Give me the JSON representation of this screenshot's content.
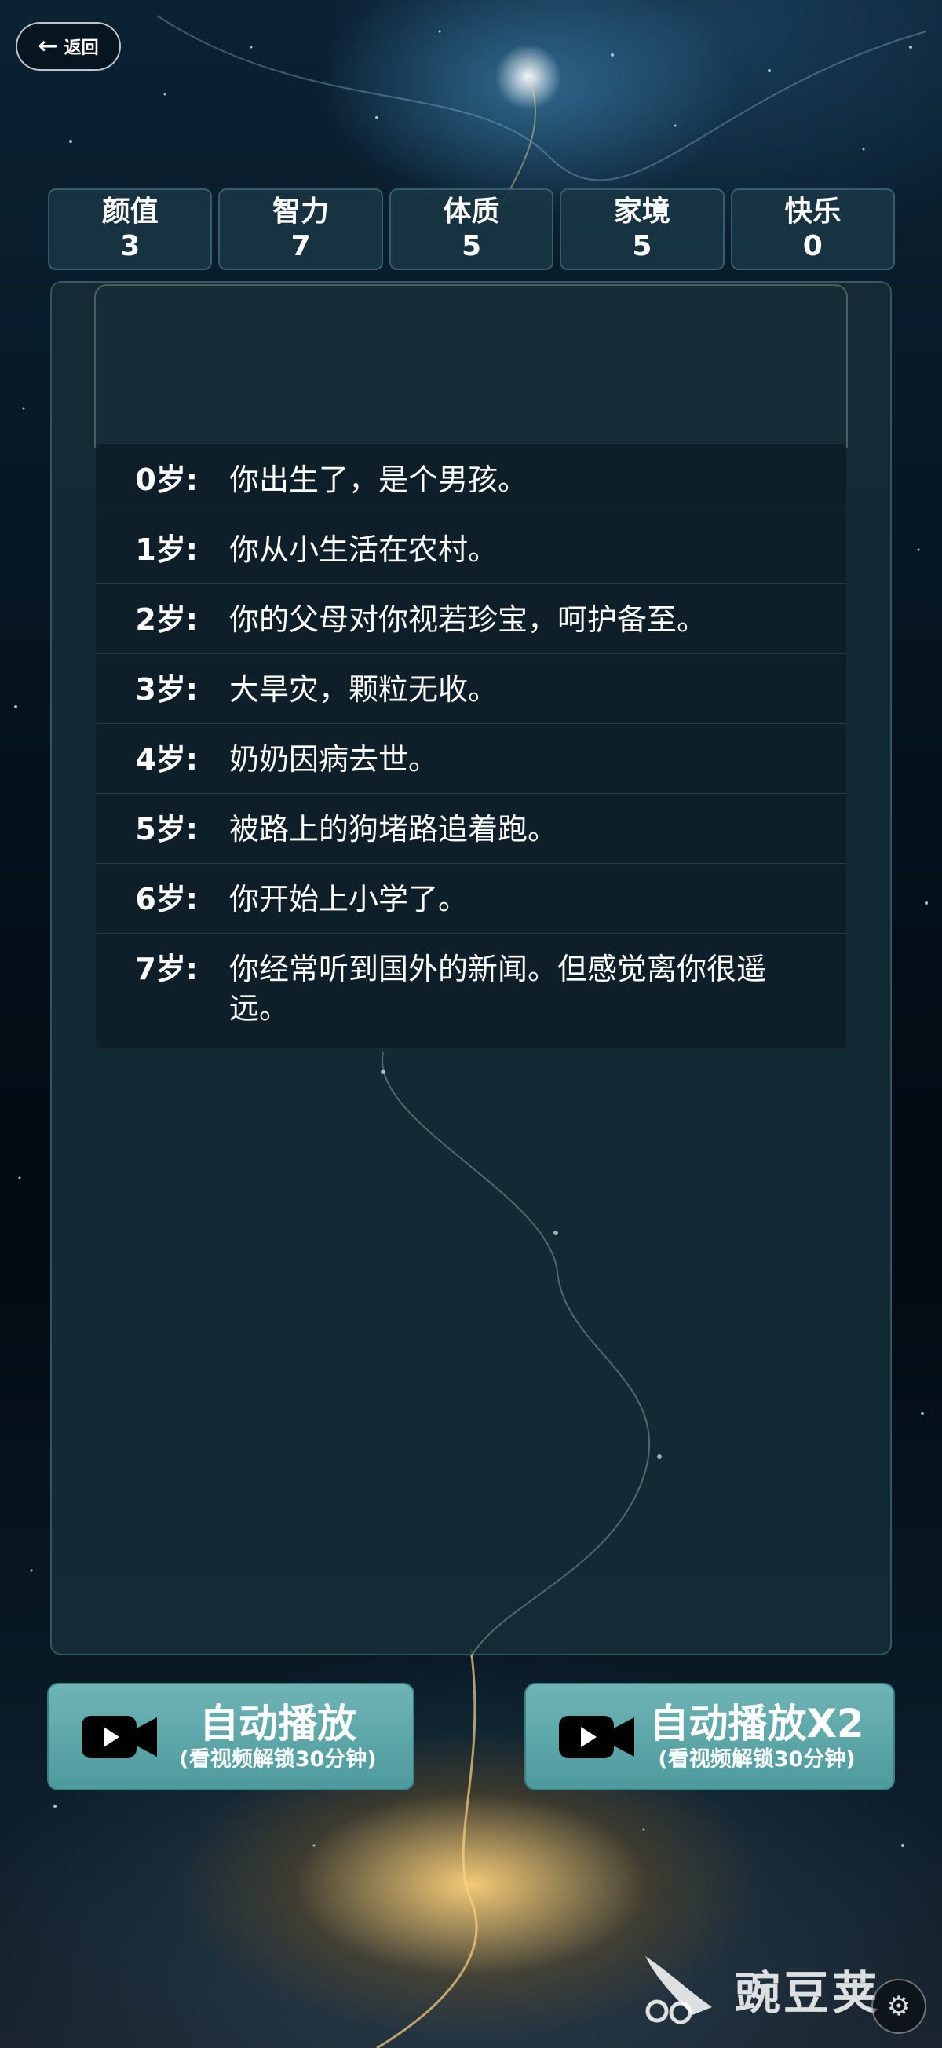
{
  "header": {
    "back_label": "返回",
    "back_icon": "arrow-left-icon"
  },
  "stats": [
    {
      "label": "颜值",
      "value": "3"
    },
    {
      "label": "智力",
      "value": "7"
    },
    {
      "label": "体质",
      "value": "5"
    },
    {
      "label": "家境",
      "value": "5"
    },
    {
      "label": "快乐",
      "value": "0"
    }
  ],
  "events": [
    {
      "age": "0岁:",
      "text": "你出生了，是个男孩。"
    },
    {
      "age": "1岁:",
      "text": "你从小生活在农村。"
    },
    {
      "age": "2岁:",
      "text": "你的父母对你视若珍宝，呵护备至。"
    },
    {
      "age": "3岁:",
      "text": "大旱灾，颗粒无收。"
    },
    {
      "age": "4岁:",
      "text": "奶奶因病去世。"
    },
    {
      "age": "5岁:",
      "text": "被路上的狗堵路追着跑。"
    },
    {
      "age": "6岁:",
      "text": "你开始上小学了。"
    },
    {
      "age": "7岁:",
      "text": "你经常听到国外的新闻。但感觉离你很遥远。"
    }
  ],
  "buttons": {
    "auto_play": {
      "title": "自动播放",
      "subtitle": "(看视频解锁30分钟)",
      "icon": "video-camera-icon"
    },
    "auto_play_x2": {
      "title": "自动播放X2",
      "subtitle": "(看视频解锁30分钟)",
      "icon": "video-camera-icon"
    }
  },
  "watermark": {
    "text": "豌豆荚",
    "icon": "wandoujia-logo-icon"
  },
  "settings": {
    "icon": "gear-icon"
  },
  "colors": {
    "button_bg": "#5aa6a9",
    "panel_bg": "#162d38",
    "stat_bg": "#19374a"
  }
}
